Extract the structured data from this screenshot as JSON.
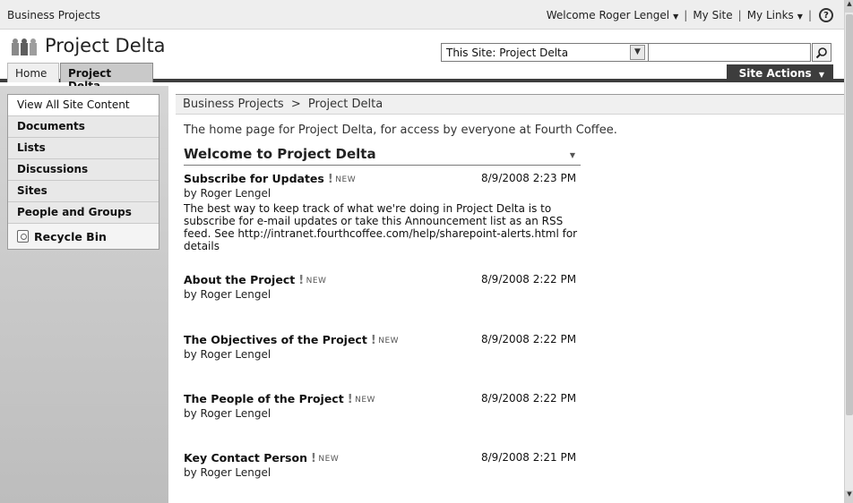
{
  "global": {
    "site_collection": "Business Projects",
    "welcome": "Welcome Roger Lengel",
    "my_site": "My Site",
    "my_links": "My Links",
    "help": "?"
  },
  "title": {
    "site_title": "Project Delta"
  },
  "search": {
    "scope": "This Site: Project Delta",
    "query": ""
  },
  "tabs": [
    {
      "label": "Home"
    },
    {
      "label": "Project Delta"
    }
  ],
  "site_actions": "Site Actions",
  "quicklaunch": {
    "view_all": "View All Site Content",
    "items": [
      {
        "label": "Documents"
      },
      {
        "label": "Lists"
      },
      {
        "label": "Discussions"
      },
      {
        "label": "Sites"
      },
      {
        "label": "People and Groups"
      }
    ],
    "recycle_bin": "Recycle Bin"
  },
  "breadcrumb": {
    "parent": "Business Projects",
    "separator": ">",
    "current": "Project Delta"
  },
  "description": "The home page for Project Delta, for access by everyone at Fourth Coffee.",
  "webpart": {
    "title": "Welcome to Project Delta",
    "new_label": "NEW",
    "announcements": [
      {
        "title": "Subscribe for Updates",
        "date": "8/9/2008 2:23 PM",
        "by": "by Roger Lengel",
        "body": "The best way to keep track of what we're doing in Project Delta is to subscribe for e-mail updates or take this Announcement list as an RSS feed. See http://intranet.fourthcoffee.com/help/sharepoint-alerts.html for details"
      },
      {
        "title": "About the Project",
        "date": "8/9/2008 2:22 PM",
        "by": "by Roger Lengel"
      },
      {
        "title": "The Objectives of the Project",
        "date": "8/9/2008 2:22 PM",
        "by": "by Roger Lengel"
      },
      {
        "title": "The People of the Project",
        "date": "8/9/2008 2:22 PM",
        "by": "by Roger Lengel"
      },
      {
        "title": "Key Contact Person",
        "date": "8/9/2008 2:21 PM",
        "by": "by Roger Lengel"
      }
    ]
  }
}
